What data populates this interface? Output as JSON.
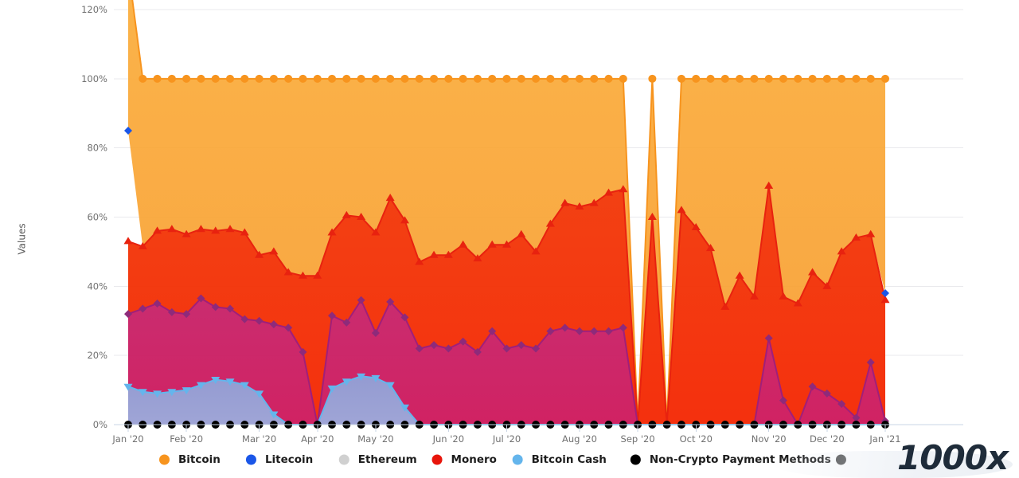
{
  "chart_data": {
    "type": "area",
    "stacked": true,
    "title": "",
    "subtitle": "",
    "xlabel": "",
    "ylabel": "Values",
    "ylim": [
      0,
      120
    ],
    "y_ticks": [
      "0%",
      "20%",
      "40%",
      "60%",
      "80%",
      "100%",
      "120%"
    ],
    "y_tick_values": [
      0,
      20,
      40,
      60,
      80,
      100,
      120
    ],
    "grid": true,
    "legend_position": "bottom",
    "x_tick_labels": [
      "Jan '20",
      "Feb '20",
      "Mar '20",
      "Apr '20",
      "May '20",
      "Jun '20",
      "Jul '20",
      "Aug '20",
      "Sep '20",
      "Oct '20",
      "Nov '20",
      "Dec '20",
      "Jan '21"
    ],
    "x_tick_indices": [
      0,
      4,
      9,
      13,
      17,
      22,
      26,
      31,
      35,
      39,
      44,
      48,
      52
    ],
    "x": [
      "2020-01-01",
      "2020-01-08",
      "2020-01-15",
      "2020-01-22",
      "2020-01-29",
      "2020-02-05",
      "2020-02-12",
      "2020-02-19",
      "2020-02-26",
      "2020-03-04",
      "2020-03-11",
      "2020-03-18",
      "2020-03-25",
      "2020-04-01",
      "2020-04-08",
      "2020-04-15",
      "2020-04-22",
      "2020-04-29",
      "2020-05-06",
      "2020-05-13",
      "2020-05-20",
      "2020-05-27",
      "2020-06-03",
      "2020-06-10",
      "2020-06-17",
      "2020-06-24",
      "2020-07-01",
      "2020-07-08",
      "2020-07-15",
      "2020-07-22",
      "2020-07-29",
      "2020-08-05",
      "2020-08-12",
      "2020-08-19",
      "2020-08-26",
      "2020-09-02",
      "2020-09-09",
      "2020-09-16",
      "2020-09-23",
      "2020-09-30",
      "2020-10-07",
      "2020-10-14",
      "2020-10-21",
      "2020-10-28",
      "2020-11-04",
      "2020-11-11",
      "2020-11-18",
      "2020-11-25",
      "2020-12-02",
      "2020-12-09",
      "2020-12-16",
      "2020-12-23",
      "2020-12-30"
    ],
    "series": [
      {
        "name": "Non-Crypto Payment Methods",
        "color": "#000000",
        "marker": "circle",
        "values": [
          0,
          0,
          0,
          0,
          0,
          0,
          0,
          0,
          0,
          0,
          0,
          0,
          0,
          0,
          0,
          0,
          0,
          0,
          0,
          0,
          0,
          0,
          0,
          0,
          0,
          0,
          0,
          0,
          0,
          0,
          0,
          0,
          0,
          0,
          0,
          0,
          0,
          0,
          0,
          0,
          0,
          0,
          0,
          0,
          0,
          0,
          0,
          0,
          0,
          0,
          0,
          0,
          0
        ]
      },
      {
        "name": "Bitcoin Cash",
        "color": "#64b5ec",
        "marker": "triangle-down",
        "values": [
          11,
          9.5,
          9,
          9.5,
          10,
          11.5,
          13,
          12.5,
          11.5,
          9,
          3,
          0,
          0,
          0,
          10.5,
          12.5,
          14,
          13.5,
          11.5,
          5,
          0,
          0,
          0,
          0,
          0,
          0,
          0,
          0,
          0,
          0,
          0,
          0,
          0,
          0,
          0,
          0,
          0,
          0,
          0,
          0,
          0,
          0,
          0,
          0,
          0,
          0,
          0,
          0,
          0,
          0,
          0,
          0,
          0
        ]
      },
      {
        "name": "Ethereum",
        "color": "#b8007a",
        "marker": "diamond",
        "values": [
          21,
          24,
          26,
          23,
          22,
          25,
          21,
          21,
          19,
          21,
          26,
          28,
          21,
          0,
          21,
          17,
          22,
          13,
          24,
          26,
          22,
          23,
          22,
          24,
          21,
          27,
          22,
          23,
          22,
          27,
          28,
          27,
          27,
          27,
          28,
          0,
          0,
          0,
          0,
          0,
          0,
          0,
          0,
          0,
          25,
          7,
          0,
          11,
          9,
          6,
          2,
          18,
          1
        ]
      },
      {
        "name": "Monero",
        "color": "#e8220f",
        "marker": "triangle-up",
        "values": [
          21,
          18,
          21,
          24,
          23,
          20,
          22,
          23,
          25,
          19,
          21,
          16,
          22,
          43,
          24,
          31,
          24,
          29,
          30,
          28,
          25,
          26,
          27,
          28,
          27,
          25,
          30,
          32,
          28,
          31,
          36,
          36,
          37,
          40,
          40,
          0,
          60,
          0,
          62,
          57,
          51,
          34,
          43,
          37,
          44,
          30,
          35,
          33,
          31,
          44,
          52,
          37,
          35
        ]
      },
      {
        "name": "Litecoin",
        "color": "#1a56e8",
        "marker": "diamond",
        "values": [
          32,
          0,
          0,
          0,
          0,
          0,
          0,
          0,
          0,
          0,
          0,
          0,
          0,
          0,
          0,
          0,
          0,
          0,
          0,
          0,
          0,
          0,
          0,
          0,
          0,
          0,
          0,
          0,
          0,
          0,
          0,
          0,
          0,
          0,
          0,
          0,
          0,
          0,
          0,
          0,
          0,
          0,
          0,
          0,
          0,
          0,
          0,
          0,
          0,
          0,
          0,
          0,
          2
        ]
      },
      {
        "name": "Bitcoin",
        "color": "#f7941e",
        "marker": "circle",
        "values": [
          47,
          48.5,
          44,
          43.5,
          45,
          43.5,
          44,
          43.5,
          44.5,
          51,
          50,
          56,
          57,
          57,
          44.5,
          39.5,
          40,
          44.5,
          34.5,
          41,
          53,
          51,
          51,
          48,
          52,
          48,
          48,
          45,
          50,
          42,
          36,
          37,
          36,
          33,
          32,
          0,
          40,
          0,
          38,
          43,
          49,
          66,
          57,
          63,
          31,
          63,
          65,
          56,
          60,
          50,
          46,
          45,
          62
        ]
      }
    ],
    "axis_colors": {
      "gridline": "#e9e9ec",
      "axisline": "#c9d4e4",
      "tick_text": "#707070"
    },
    "extra_legend_swatch": {
      "color": "#4a4a4a",
      "label": ""
    }
  },
  "legend": {
    "items": [
      {
        "label": "Bitcoin",
        "color": "#f7941e",
        "shape": "circle"
      },
      {
        "label": "Litecoin",
        "color": "#1a56e8",
        "shape": "circle"
      },
      {
        "label": "Ethereum",
        "color": "#d0d0d0",
        "shape": "circle"
      },
      {
        "label": "Monero",
        "color": "#e8150b",
        "shape": "circle"
      },
      {
        "label": "Bitcoin Cash",
        "color": "#64b5ec",
        "shape": "circle"
      },
      {
        "label": "Non-Crypto Payment Methods",
        "color": "#000000",
        "shape": "circle"
      },
      {
        "label": "",
        "color": "#4a4a4a",
        "shape": "circle"
      }
    ]
  },
  "watermark": {
    "text": "1000x"
  }
}
